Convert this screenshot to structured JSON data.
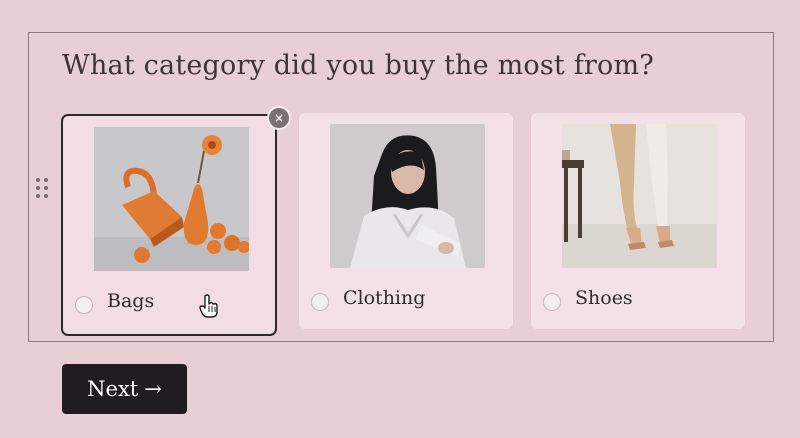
{
  "question": {
    "title": "What category did you buy the most from?"
  },
  "options": [
    {
      "label": "Bags",
      "image": "bag-product-photo",
      "selected": true
    },
    {
      "label": "Clothing",
      "image": "clothing-model-photo",
      "selected": false
    },
    {
      "label": "Shoes",
      "image": "shoes-legs-photo",
      "selected": false
    }
  ],
  "controls": {
    "next_label": "Next",
    "next_icon": "→",
    "remove_icon": "×",
    "drag_icon": "drag-handle-icon"
  },
  "colors": {
    "background": "#e8cfd6",
    "card": "#f3e1e7",
    "selected_border": "#2d2a2c",
    "button": "#1f1d20"
  }
}
